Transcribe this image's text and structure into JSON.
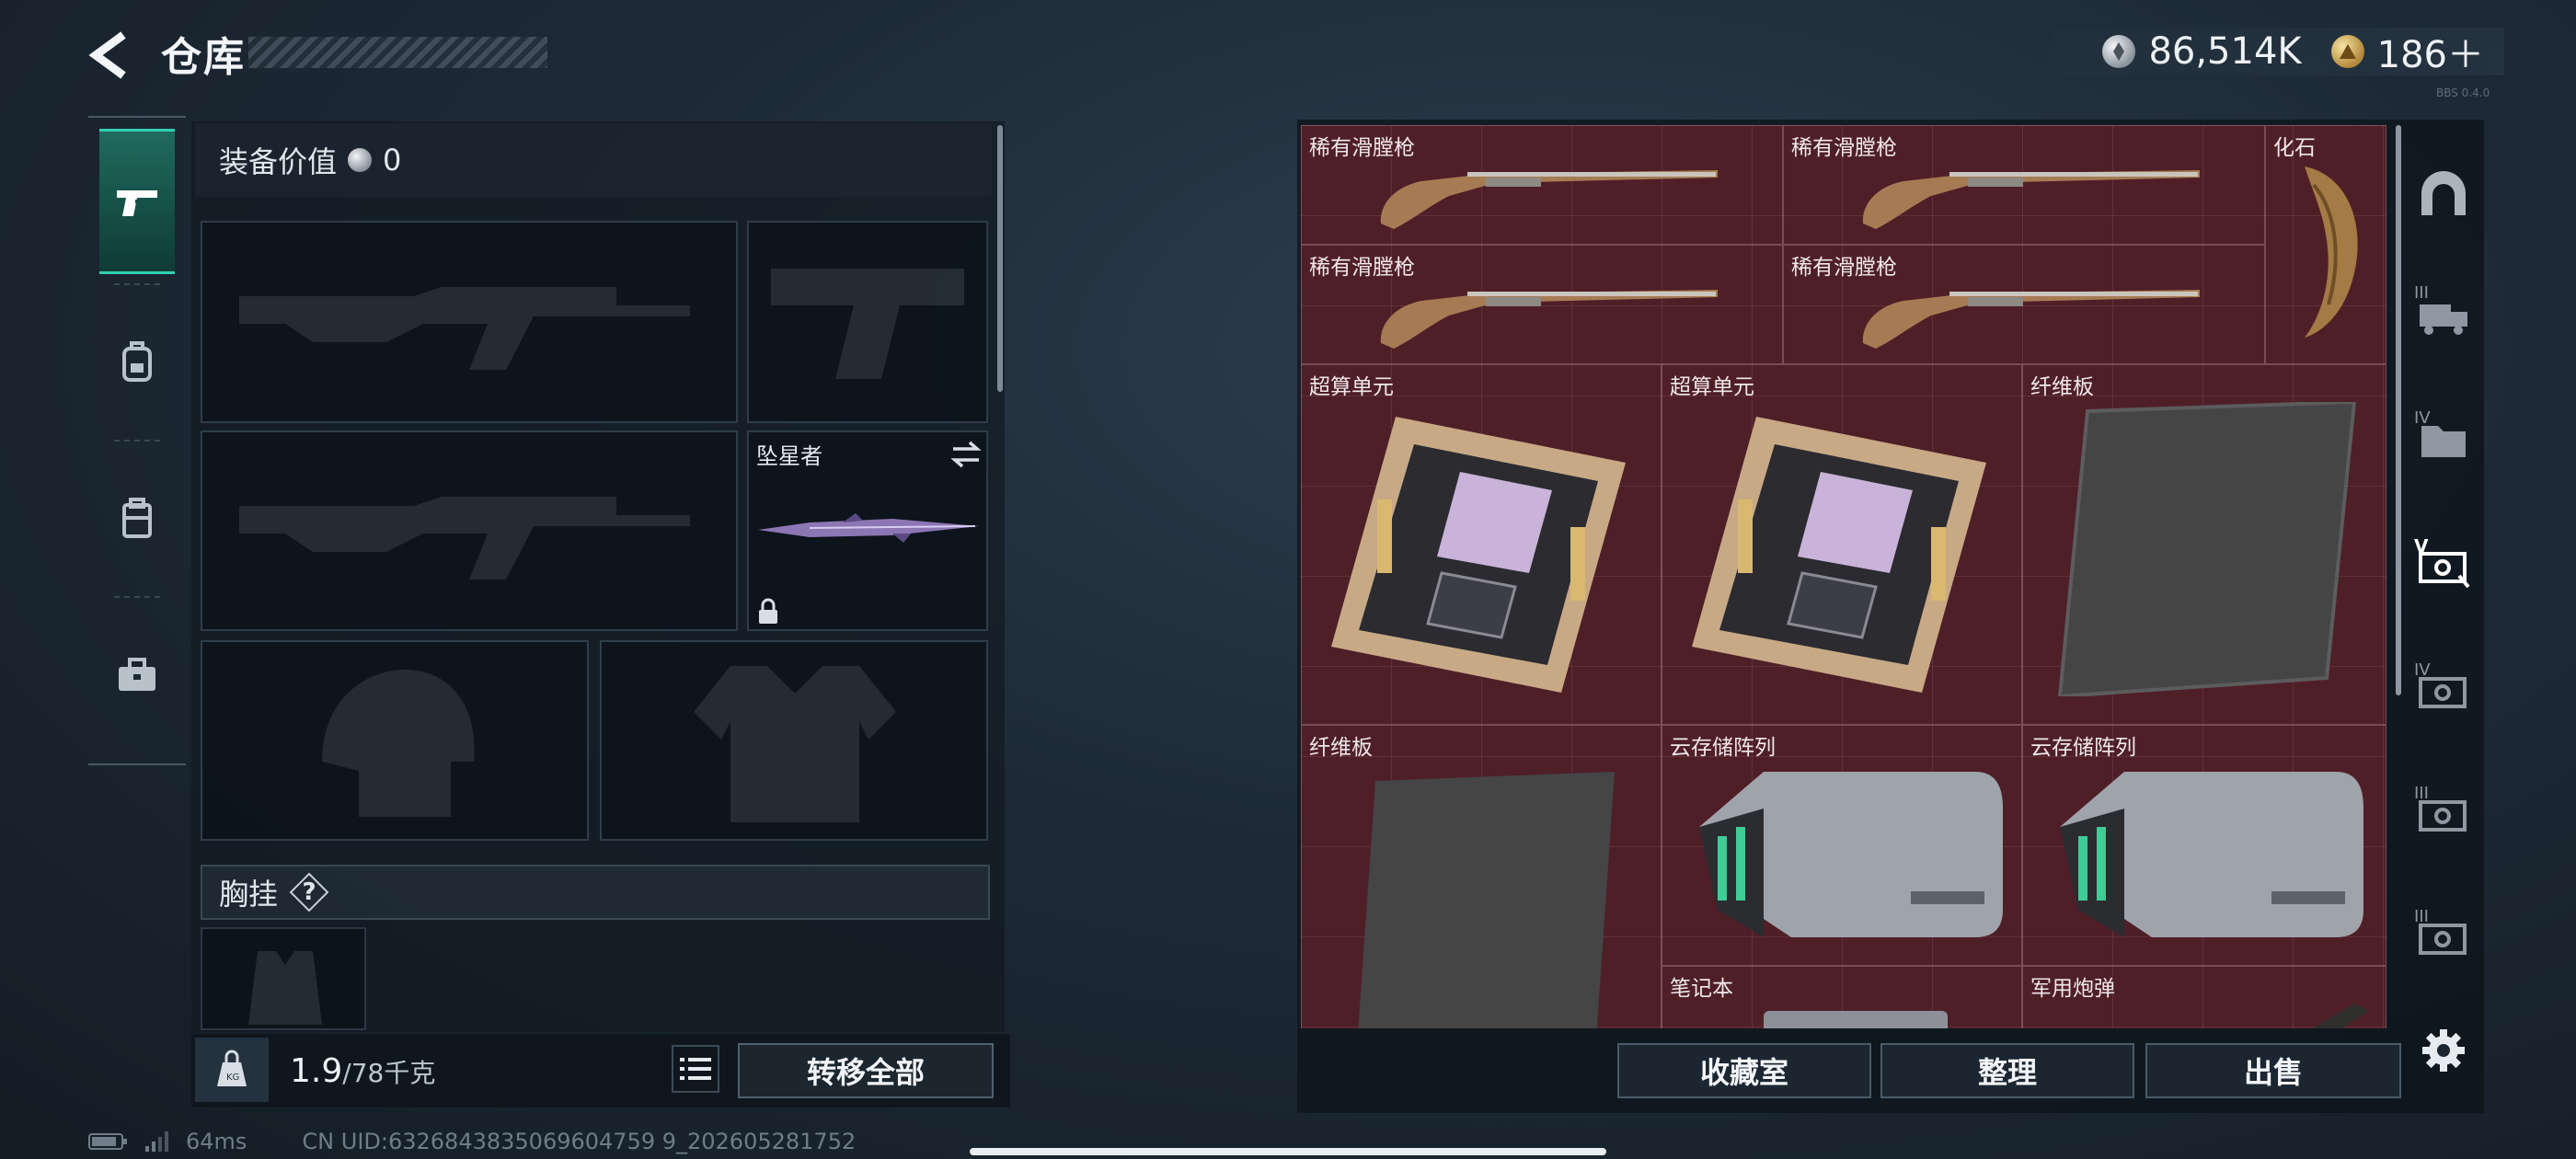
{
  "header": {
    "title": "仓库",
    "currencies": [
      {
        "icon": "silver-coin-icon",
        "value": "86,514K"
      },
      {
        "icon": "gold-coin-icon",
        "value": "186＋"
      }
    ],
    "version_mark": "BBS 0.4.0"
  },
  "category_nav": {
    "items": [
      {
        "name": "weapons",
        "icon": "pistol-icon",
        "active": true
      },
      {
        "name": "equipment",
        "icon": "backpack-icon",
        "active": false
      },
      {
        "name": "containers",
        "icon": "case-icon",
        "active": false
      },
      {
        "name": "toolbox",
        "icon": "briefcase-icon",
        "active": false
      }
    ]
  },
  "loadout": {
    "equip_value_label": "装备价值",
    "equip_value": "0",
    "slots": {
      "primary_1": "",
      "sidearm": "",
      "primary_2": "",
      "melee": {
        "name": "坠星者",
        "locked": true
      },
      "helmet": "",
      "armor": ""
    },
    "chest_rig_label": "胸挂",
    "help_symbol": "?",
    "weight_value": "1.9",
    "weight_capacity": "/78千克",
    "transfer_all_label": "转移全部"
  },
  "storage": {
    "items": [
      {
        "name": "稀有滑膛枪",
        "type": "musket"
      },
      {
        "name": "稀有滑膛枪",
        "type": "musket"
      },
      {
        "name": "化石",
        "type": "fossil"
      },
      {
        "name": "稀有滑膛枪",
        "type": "musket"
      },
      {
        "name": "稀有滑膛枪",
        "type": "musket"
      },
      {
        "name": "超算单元",
        "type": "supercomputer"
      },
      {
        "name": "超算单元",
        "type": "supercomputer"
      },
      {
        "name": "纤维板",
        "type": "fiberboard"
      },
      {
        "name": "纤维板",
        "type": "fiberboard"
      },
      {
        "name": "云存储阵列",
        "type": "storage-array"
      },
      {
        "name": "云存储阵列",
        "type": "storage-array"
      },
      {
        "name": "笔记本",
        "type": "laptop"
      },
      {
        "name": "军用炮弹",
        "type": "shell"
      }
    ],
    "rail": [
      {
        "label": "",
        "icon": "dome-icon"
      },
      {
        "label": "III",
        "icon": "truck-icon"
      },
      {
        "label": "IV",
        "icon": "folder-icon"
      },
      {
        "label": "V",
        "icon": "cash-icon",
        "active": true
      },
      {
        "label": "IV",
        "icon": "cash-icon"
      },
      {
        "label": "III",
        "icon": "cash-icon"
      },
      {
        "label": "III",
        "icon": "cash-icon"
      }
    ],
    "buttons": {
      "collection": "收藏室",
      "organize": "整理",
      "sell": "出售"
    }
  },
  "status": {
    "ping": "64ms",
    "uid": "CN UID:6326843835069604759 9_202605281752"
  },
  "colors": {
    "accent_teal": "#2fd0b0",
    "storage_bg": "#4f1f28",
    "panel_bg": "#121a22"
  }
}
